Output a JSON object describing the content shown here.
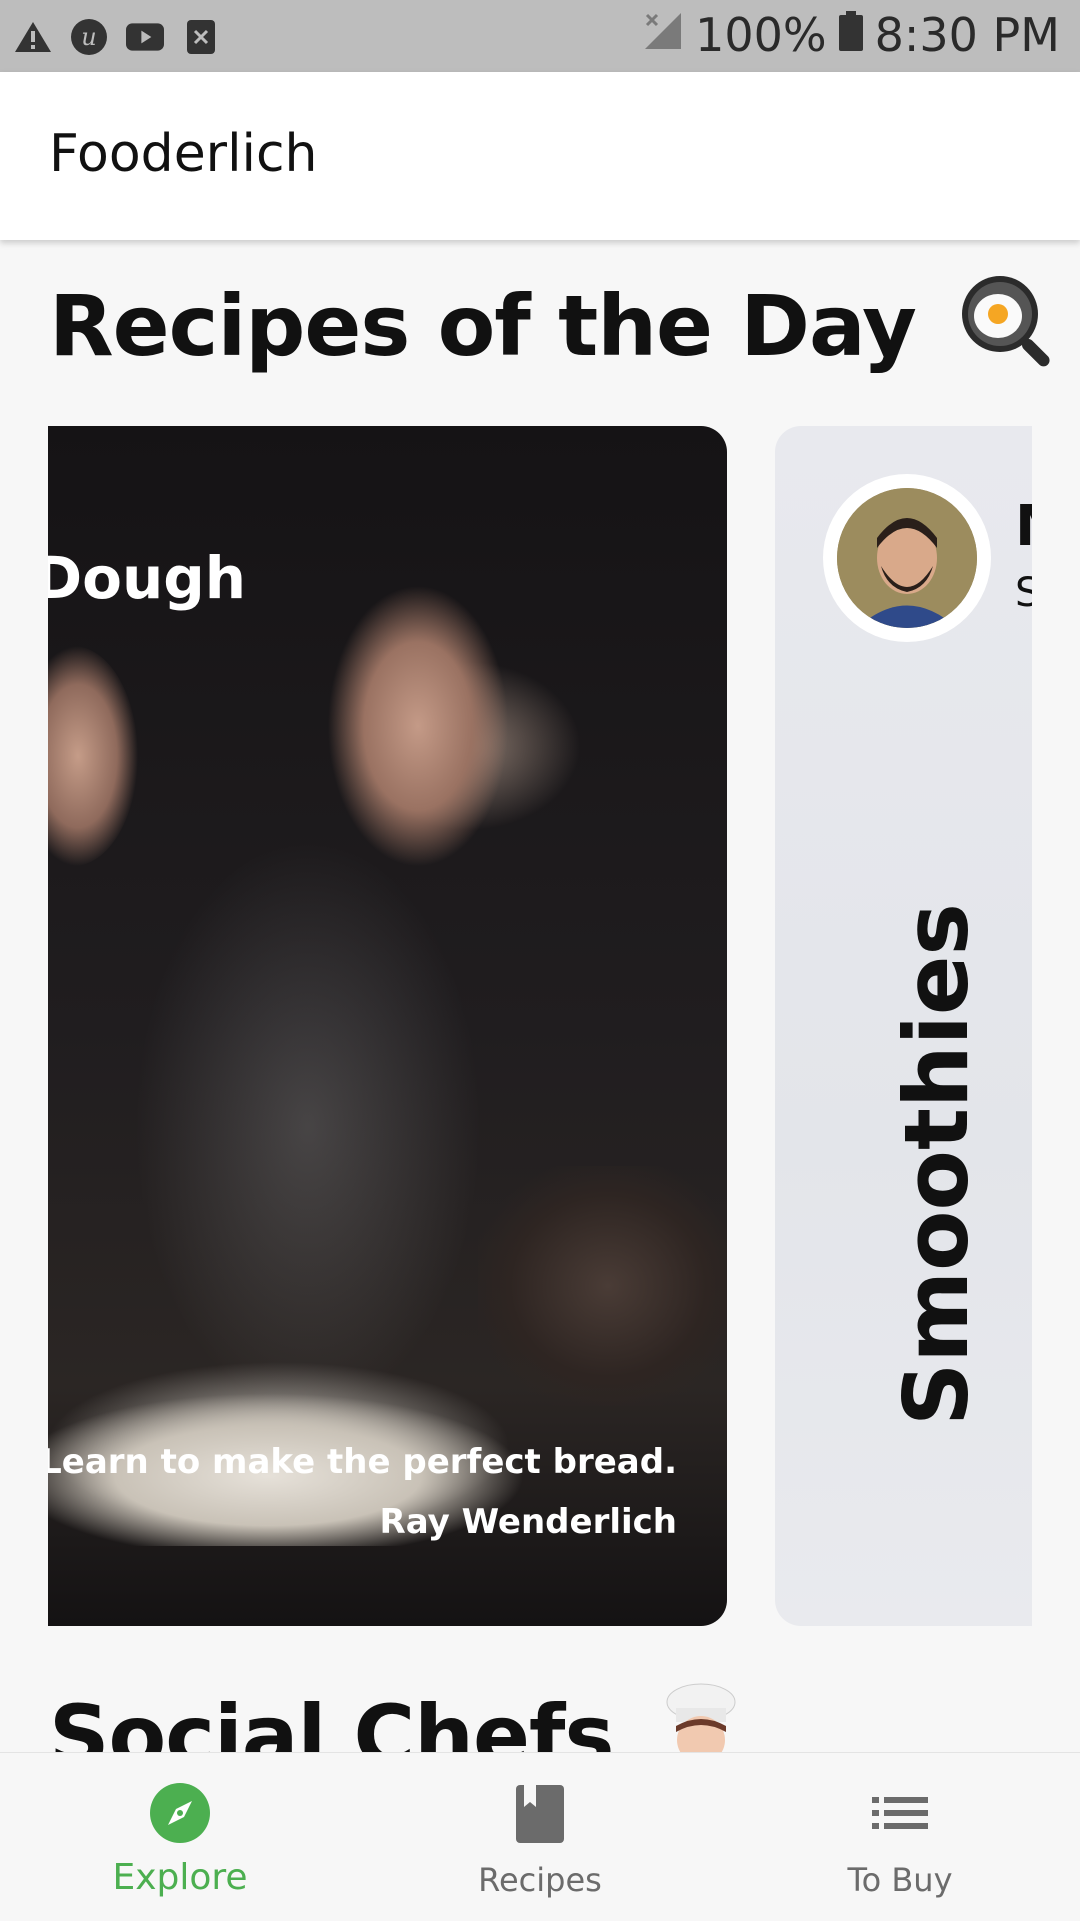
{
  "status_bar": {
    "battery_percent": "100%",
    "time": "8:30 PM",
    "icons": [
      "warning-icon",
      "app-u-icon",
      "youtube-icon",
      "close-box-icon",
      "signal-off-icon",
      "battery-icon"
    ]
  },
  "app_bar": {
    "title": "Fooderlich"
  },
  "recipes_section": {
    "title": "Recipes of the Day",
    "icon": "frying-pan-egg-icon"
  },
  "card1": {
    "title": "Dough",
    "description": "Learn to make the perfect bread.",
    "author": "Ray Wenderlich"
  },
  "card2": {
    "name_initial": "M",
    "subtitle_initial": "S",
    "title": "Smoothies"
  },
  "social_section": {
    "title": "Social Chefs",
    "icon": "chef-icon"
  },
  "bottom_nav": {
    "items": [
      {
        "label": "Explore",
        "icon": "compass-icon",
        "active": true
      },
      {
        "label": "Recipes",
        "icon": "book-icon",
        "active": false
      },
      {
        "label": "To Buy",
        "icon": "list-icon",
        "active": false
      }
    ]
  },
  "colors": {
    "accent": "#4caf50",
    "status_bar": "#bdbdbd",
    "background": "#f7f7f7"
  }
}
